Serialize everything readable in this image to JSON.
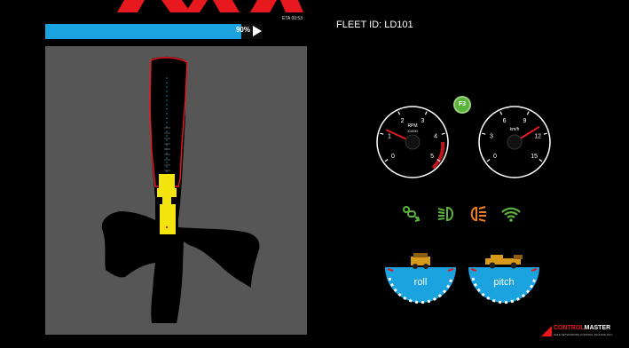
{
  "colors": {
    "accent": "#1aa3de",
    "route_outline": "#e8191e",
    "vehicle": "#f2e40c",
    "status_green": "#5ab43a",
    "status_orange": "#f07e1b",
    "map_background": "#565656"
  },
  "progress": {
    "percent": 90,
    "label": "90%"
  },
  "eta": "ETA 00:53",
  "fleet": {
    "label": "FLEET ID: LD101"
  },
  "badge": {
    "label": "F3"
  },
  "gauges": {
    "rpm": {
      "unit": "RPM",
      "multiplier": "X1000",
      "ticks": [
        "0",
        "1",
        "2",
        "3",
        "4",
        "5"
      ],
      "value": 1.2,
      "max": 5
    },
    "speed": {
      "unit": "km/h",
      "ticks": [
        "0",
        "3",
        "6",
        "9",
        "12",
        "15"
      ],
      "value": 11,
      "max": 15
    }
  },
  "status_icons": [
    {
      "icon": "towing-chain-icon",
      "color": "#5ab43a"
    },
    {
      "icon": "headlights-icon",
      "color": "#5ab43a"
    },
    {
      "icon": "hazard-lights-icon",
      "color": "#f07e1b"
    },
    {
      "icon": "wifi-icon",
      "color": "#5ab43a"
    }
  ],
  "tilt": {
    "roll_label": "roll",
    "pitch_label": "pitch"
  },
  "logo": {
    "brand": "CONTROLMASTER",
    "tagline": "SAFE NETWORKING CONTROL TECHNOLOGY"
  }
}
